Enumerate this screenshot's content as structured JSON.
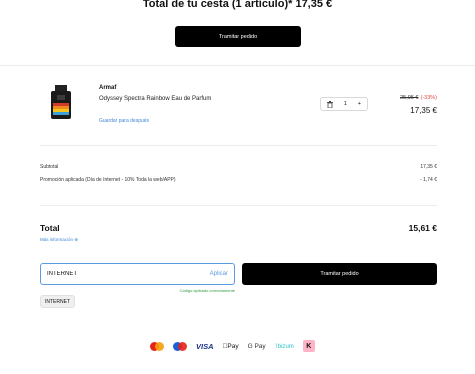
{
  "header": {
    "title": "Total de tu cesta (1 artículo)* 17,35 €",
    "checkout_label": "Tramitar pedido"
  },
  "item": {
    "brand": "Armaf",
    "name": "Odyssey Spectra Rainbow Eau de Parfum",
    "save_later": "Guardar para después",
    "quantity": "1",
    "qty_minus_icon": "trash-icon",
    "qty_plus": "+",
    "price_old": "25,95 €",
    "discount": "(-33%)",
    "price_new": "17,35 €"
  },
  "summary": {
    "subtotal_label": "Subtotal",
    "subtotal_value": "17,35 €",
    "promo_label": "Promoción aplicada (Día de Internet - 10% Toda la web/APP)",
    "promo_value": "- 1,74 €"
  },
  "total": {
    "label": "Total",
    "value": "15,61 €",
    "more_info": "Más información ⊕"
  },
  "coupon": {
    "value": "INTERNET",
    "apply_label": "Aplicar",
    "success_text": "Código aplicado correctamente",
    "applied_chip": "INTERNET"
  },
  "checkout": {
    "label": "Tramitar pedido"
  },
  "payments": {
    "icons": [
      "mastercard-icon",
      "maestro-icon",
      "visa-icon",
      "apple-pay-icon",
      "google-pay-icon",
      "bizum-icon",
      "klarna-icon"
    ],
    "visa": "VISA",
    "apple_pay": "Pay",
    "google_pay": "G Pay",
    "bizum": "bizum",
    "klarna": "K"
  },
  "colors": {
    "accent_link": "#3f87d6",
    "discount": "#e2463b",
    "success": "#2e9a3a",
    "primary_button": "#000000"
  }
}
